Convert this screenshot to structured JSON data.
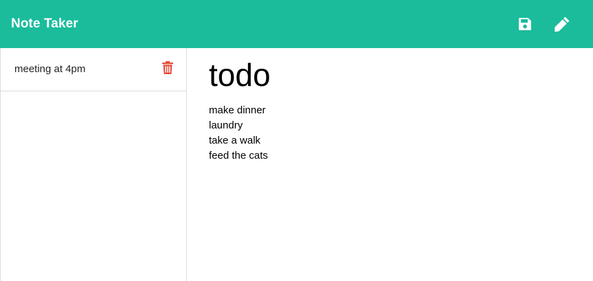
{
  "app": {
    "title": "Note Taker"
  },
  "toolbar": {
    "save_icon": "floppy-disk-icon",
    "new_note_icon": "pencil-icon"
  },
  "sidebar": {
    "items": [
      {
        "label": "meeting at 4pm",
        "delete_icon": "trash-icon"
      }
    ]
  },
  "note": {
    "title": "todo",
    "lines": [
      "make dinner",
      "laundry",
      "take a walk",
      "feed the cats"
    ]
  },
  "colors": {
    "accent": "#1abc9c",
    "delete": "#e74c3c",
    "border": "#dcdcdc"
  }
}
